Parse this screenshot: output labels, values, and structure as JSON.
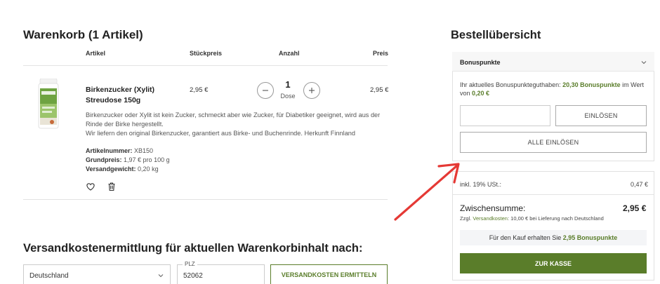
{
  "cart": {
    "title": "Warenkorb (1 Artikel)",
    "columns": {
      "article": "Artikel",
      "unit_price": "Stückpreis",
      "quantity": "Anzahl",
      "price": "Preis"
    },
    "item": {
      "name": "Birkenzucker (Xylit) Streudose 150g",
      "unit_price": "2,95 €",
      "quantity": "1",
      "quantity_unit": "Dose",
      "price": "2,95 €",
      "description": "Birkenzucker oder Xylit ist kein Zucker, schmeckt aber wie Zucker, für Diabetiker geeignet, wird aus der Rinde der Birke hergestellt.",
      "description2": "Wir liefern den original Birkenzucker, garantiert aus Birke- und Buchenrinde. Herkunft Finnland",
      "sku_label": "Artikelnummer:",
      "sku": "XB150",
      "base_price_label": "Grundpreis:",
      "base_price": "1,97 € pro 100 g",
      "weight_label": "Versandgewicht:",
      "weight": "0,20 kg"
    },
    "icons": {
      "decrease": "minus-icon",
      "increase": "plus-icon",
      "wishlist": "heart-icon",
      "remove": "trash-icon"
    }
  },
  "shipping": {
    "title": "Versandkostenermittlung für aktuellen Warenkorbinhalt nach:",
    "country": "Deutschland",
    "plz_label": "PLZ",
    "plz": "52062",
    "button": "VERSANDKOSTEN ERMITTELN"
  },
  "summary": {
    "title": "Bestellübersicht",
    "bonus": {
      "header": "Bonuspunkte",
      "text_prefix": "Ihr aktuelles Bonuspunkteguthaben:",
      "points": "20,30 Bonuspunkte",
      "text_mid": "im Wert von",
      "value": "0,20 €",
      "redeem_button": "EINLÖSEN",
      "redeem_all_button": "ALLE EINLÖSEN"
    },
    "vat_label": "inkl. 19% USt.:",
    "vat_value": "0,47 €",
    "subtotal_label": "Zwischensumme:",
    "subtotal_value": "2,95 €",
    "shipping_prefix": "Zzgl.",
    "shipping_link": "Versandkosten",
    "shipping_suffix": ": 10,00 € bei Lieferung nach Deutschland",
    "earn_prefix": "Für den Kauf erhalten Sie",
    "earn_points": "2,95 Bonuspunkte",
    "checkout_button": "ZUR KASSE"
  },
  "colors": {
    "brand_green": "#5a7d2a",
    "annotation_arrow": "#e53935"
  }
}
